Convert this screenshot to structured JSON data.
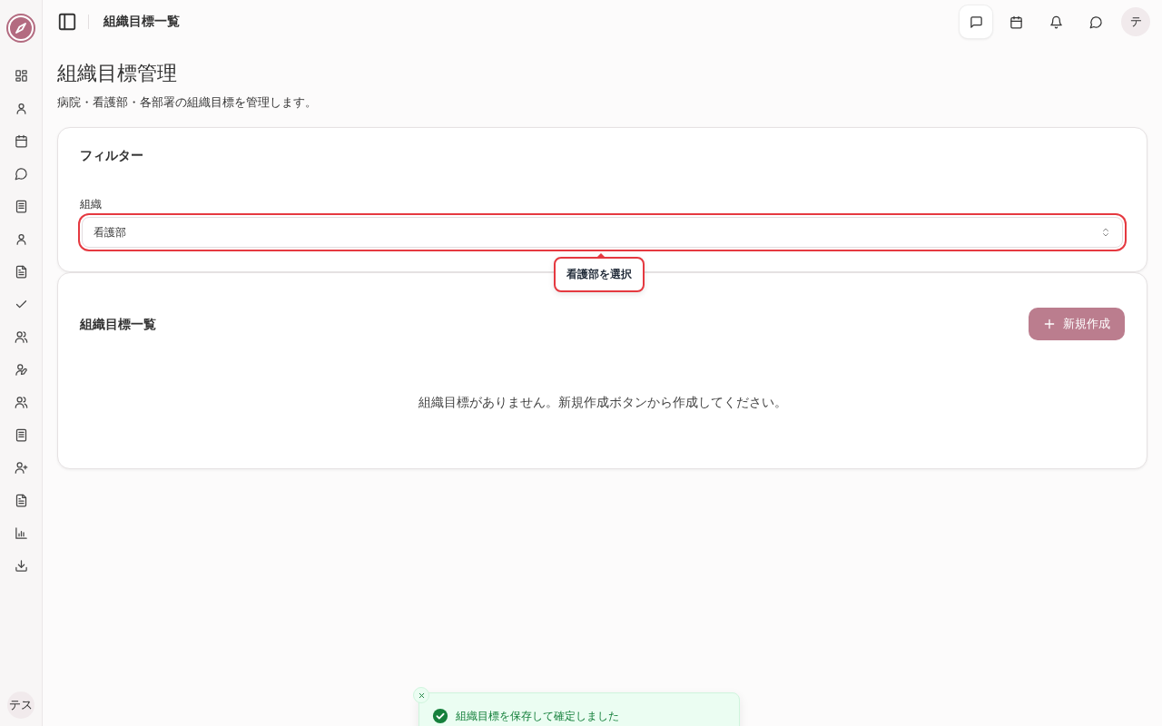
{
  "sidebar": {
    "items": [
      {
        "kind": "grid"
      },
      {
        "kind": "user"
      },
      {
        "kind": "calendar"
      },
      {
        "kind": "chat"
      },
      {
        "kind": "book"
      },
      {
        "kind": "user"
      },
      {
        "kind": "file"
      },
      {
        "kind": "check"
      },
      {
        "kind": "users"
      },
      {
        "kind": "user-edit"
      },
      {
        "kind": "users"
      },
      {
        "kind": "book"
      },
      {
        "kind": "user-plus"
      },
      {
        "kind": "file"
      },
      {
        "kind": "chart"
      },
      {
        "kind": "download"
      }
    ],
    "avatar": "テス"
  },
  "header": {
    "title": "組織目標一覧",
    "actions": [
      {
        "kind": "message",
        "focused": true
      },
      {
        "kind": "calendar",
        "focused": false
      },
      {
        "kind": "bell",
        "focused": false
      },
      {
        "kind": "chat",
        "focused": false
      }
    ],
    "avatar": "テ"
  },
  "page": {
    "title": "組織目標管理",
    "subtitle": "病院・看護部・各部署の組織目標を管理します。"
  },
  "filter": {
    "title": "フィルター",
    "field": {
      "label": "組織",
      "value": "看護部",
      "highlighted": true
    },
    "tooltip": "看護部を選択"
  },
  "list": {
    "title": "組織目標一覧",
    "new_button": {
      "label": "新規作成",
      "disabled": true
    },
    "empty_message": "組織目標がありません。新規作成ボタンから作成してください。"
  },
  "toast": {
    "message": "組織目標を保存して確定しました"
  }
}
